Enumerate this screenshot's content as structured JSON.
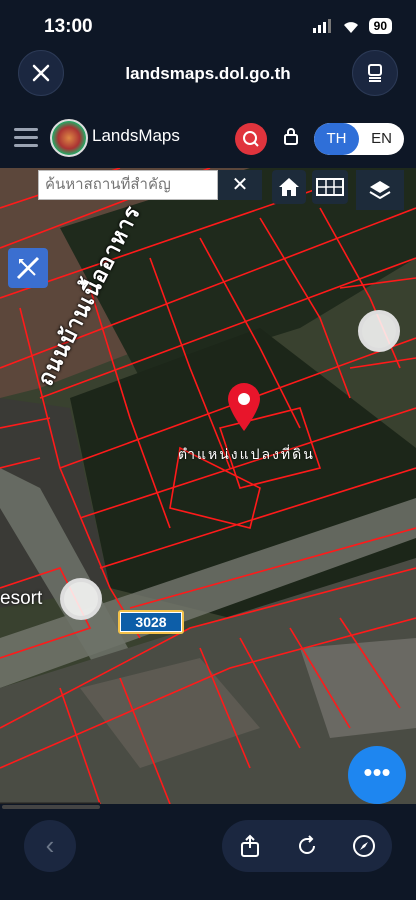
{
  "status": {
    "time": "13:00",
    "battery": "90"
  },
  "browser": {
    "url": "landsmaps.dol.go.th"
  },
  "app": {
    "name": "LandsMaps",
    "lang_th": "TH",
    "lang_en": "EN"
  },
  "map": {
    "search_placeholder": "ค้นหาสถานที่สำคัญ",
    "road_label": "ถนนบ้านเนื้ออาหาร",
    "parcel_label": "ตำแหน่งแปลงที่ดิน",
    "poi_label": "esort",
    "route_number": "3028",
    "fab_label": "•••"
  },
  "icons": [
    "close-icon",
    "tabs-icon",
    "menu-icon",
    "search-icon",
    "lock-icon",
    "home-icon",
    "grid-icon",
    "layers-icon",
    "ruler-icon",
    "pin-icon",
    "location-icon",
    "back-icon",
    "share-icon",
    "reload-icon",
    "compass-icon"
  ]
}
